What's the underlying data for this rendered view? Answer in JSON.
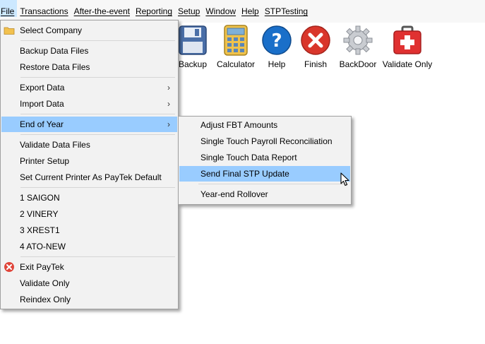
{
  "menubar": {
    "items": [
      "File",
      "Transactions",
      "After-the-event",
      "Reporting",
      "Setup",
      "Window",
      "Help",
      "STPTesting"
    ]
  },
  "toolbar": {
    "buttons": [
      {
        "label": "Backup",
        "icon": "floppy-disk-icon"
      },
      {
        "label": "Calculator",
        "icon": "calculator-icon"
      },
      {
        "label": "Help",
        "icon": "help-question-icon"
      },
      {
        "label": "Finish",
        "icon": "finish-x-icon"
      },
      {
        "label": "BackDoor",
        "icon": "gear-icon"
      },
      {
        "label": "Validate Only",
        "icon": "first-aid-kit-icon"
      }
    ]
  },
  "file_menu": {
    "items": [
      {
        "label": "Select Company",
        "icon": "folder-icon"
      },
      {
        "label": "Backup Data Files"
      },
      {
        "label": "Restore Data Files"
      },
      {
        "label": "Export Data",
        "submenu": true
      },
      {
        "label": "Import Data",
        "submenu": true
      },
      {
        "label": "End of Year",
        "submenu": true,
        "highlighted": true
      },
      {
        "label": "Validate Data Files"
      },
      {
        "label": "Printer Setup"
      },
      {
        "label": "Set Current Printer As PayTek Default"
      },
      {
        "label": "1 SAIGON"
      },
      {
        "label": "2 VINERY"
      },
      {
        "label": "3 XREST1"
      },
      {
        "label": "4 ATO-NEW"
      },
      {
        "label": "Exit PayTek",
        "icon": "exit-icon"
      },
      {
        "label": "Validate Only"
      },
      {
        "label": "Reindex Only"
      }
    ]
  },
  "end_of_year_menu": {
    "items": [
      {
        "label": "Adjust FBT Amounts"
      },
      {
        "label": "Single Touch Payroll Reconciliation"
      },
      {
        "label": "Single Touch Data Report"
      },
      {
        "label": "Send Final STP Update",
        "highlighted": true
      },
      {
        "label": "Year-end Rollover"
      }
    ]
  },
  "colors": {
    "menu_highlight": "#99ccff",
    "menubar_active": "#cce8ff",
    "help_blue": "#1a6fc9",
    "finish_red": "#d9362b",
    "kit_red": "#e03131"
  }
}
